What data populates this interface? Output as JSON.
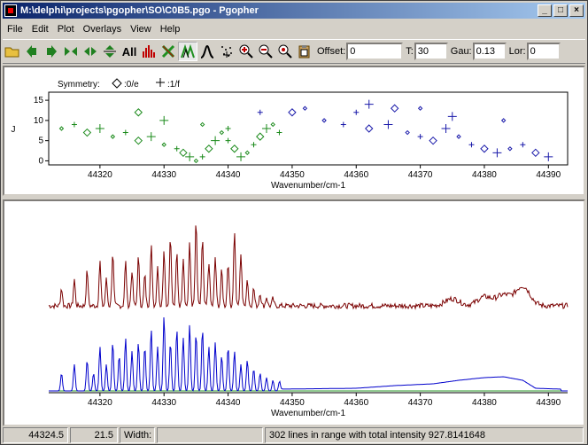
{
  "window": {
    "title": "M:\\delphi\\projects\\pgopher\\SO\\C0B5.pgo - Pgopher"
  },
  "menu": [
    "File",
    "Edit",
    "Plot",
    "Overlays",
    "View",
    "Help"
  ],
  "toolbar": {
    "all_label": "All",
    "offset_label": "Offset:",
    "offset_value": "0",
    "t_label": "T:",
    "t_value": "30",
    "gau_label": "Gau:",
    "gau_value": "0.13",
    "lor_label": "Lor:",
    "lor_value": "0"
  },
  "status": {
    "x": "44324.5",
    "y": "21.5",
    "width_label": "Width:",
    "width_value": "",
    "message": "302 lines in range with total intensity 927.8141648"
  },
  "colors": {
    "e_symmetry": "#1a8a1a",
    "f_symmetry": "#1a1aaa",
    "observed": "#7a0000",
    "simulated": "#0000cc"
  },
  "chart_data": [
    {
      "type": "scatter",
      "title": "",
      "xlabel": "Wavenumber/cm-1",
      "ylabel": "J",
      "legend_title": "Symmetry:",
      "legend": [
        {
          "symbol": "diamond",
          "label": ":0/e"
        },
        {
          "symbol": "cross",
          "label": ":1/f"
        }
      ],
      "xlim": [
        44312,
        44393
      ],
      "ylim": [
        -1,
        17
      ],
      "xticks": [
        44320,
        44330,
        44340,
        44350,
        44360,
        44370,
        44380,
        44390
      ],
      "yticks": [
        0,
        5,
        10,
        15
      ],
      "series": [
        {
          "name": "e",
          "points": [
            [
              44314,
              8
            ],
            [
              44316,
              9
            ],
            [
              44318,
              7
            ],
            [
              44320,
              8
            ],
            [
              44322,
              6
            ],
            [
              44324,
              7
            ],
            [
              44326,
              5
            ],
            [
              44328,
              6
            ],
            [
              44330,
              4
            ],
            [
              44332,
              3
            ],
            [
              44333,
              2
            ],
            [
              44334,
              1
            ],
            [
              44335,
              0
            ],
            [
              44336,
              1
            ],
            [
              44337,
              3
            ],
            [
              44338,
              5
            ],
            [
              44339,
              7
            ],
            [
              44340,
              5
            ],
            [
              44341,
              3
            ],
            [
              44342,
              1
            ],
            [
              44343,
              2
            ],
            [
              44344,
              4
            ],
            [
              44345,
              6
            ],
            [
              44346,
              8
            ],
            [
              44347,
              9
            ],
            [
              44348,
              7
            ],
            [
              44326,
              12
            ],
            [
              44330,
              10
            ],
            [
              44336,
              9
            ],
            [
              44340,
              8
            ]
          ]
        },
        {
          "name": "f",
          "points": [
            [
              44355,
              10
            ],
            [
              44358,
              9
            ],
            [
              44362,
              8
            ],
            [
              44365,
              9
            ],
            [
              44368,
              7
            ],
            [
              44370,
              6
            ],
            [
              44372,
              5
            ],
            [
              44374,
              8
            ],
            [
              44376,
              6
            ],
            [
              44378,
              4
            ],
            [
              44380,
              3
            ],
            [
              44382,
              2
            ],
            [
              44384,
              3
            ],
            [
              44386,
              4
            ],
            [
              44388,
              2
            ],
            [
              44390,
              1
            ],
            [
              44352,
              13
            ],
            [
              44360,
              12
            ],
            [
              44366,
              13
            ],
            [
              44375,
              11
            ],
            [
              44383,
              10
            ],
            [
              44345,
              12
            ],
            [
              44350,
              12
            ],
            [
              44362,
              14
            ],
            [
              44370,
              13
            ]
          ]
        }
      ]
    },
    {
      "type": "line",
      "title": "",
      "xlabel": "Wavenumber/cm-1",
      "xlim": [
        44312,
        44393
      ],
      "xticks": [
        44320,
        44330,
        44340,
        44350,
        44360,
        44370,
        44380,
        44390
      ],
      "series": [
        {
          "name": "",
          "role": "observed",
          "peaks": [
            [
              44314,
              0.2
            ],
            [
              44316,
              0.3
            ],
            [
              44318,
              0.4
            ],
            [
              44320,
              0.5
            ],
            [
              44321,
              0.3
            ],
            [
              44322,
              0.6
            ],
            [
              44324,
              0.5
            ],
            [
              44325,
              0.4
            ],
            [
              44326,
              0.55
            ],
            [
              44327,
              0.35
            ],
            [
              44328,
              0.7
            ],
            [
              44329,
              0.45
            ],
            [
              44330,
              0.65
            ],
            [
              44331,
              0.8
            ],
            [
              44332,
              0.6
            ],
            [
              44333,
              0.55
            ],
            [
              44334,
              0.7
            ],
            [
              44335,
              0.95
            ],
            [
              44336,
              0.75
            ],
            [
              44337,
              0.5
            ],
            [
              44338,
              0.55
            ],
            [
              44339,
              0.4
            ],
            [
              44340,
              0.5
            ],
            [
              44341,
              0.85
            ],
            [
              44342,
              0.6
            ],
            [
              44343,
              0.3
            ],
            [
              44344,
              0.2
            ],
            [
              44345,
              0.15
            ],
            [
              44346,
              0.1
            ],
            [
              44347,
              0.08
            ]
          ],
          "bumps": [
            [
              44375,
              0.08
            ],
            [
              44380,
              0.1
            ],
            [
              44383,
              0.12
            ],
            [
              44386,
              0.22
            ]
          ]
        },
        {
          "name": "",
          "role": "simulated",
          "peaks": [
            [
              44314,
              0.2
            ],
            [
              44316,
              0.3
            ],
            [
              44318,
              0.35
            ],
            [
              44319,
              0.2
            ],
            [
              44320,
              0.5
            ],
            [
              44321,
              0.3
            ],
            [
              44322,
              0.55
            ],
            [
              44323,
              0.4
            ],
            [
              44324,
              0.6
            ],
            [
              44325,
              0.45
            ],
            [
              44326,
              0.55
            ],
            [
              44327,
              0.5
            ],
            [
              44328,
              0.7
            ],
            [
              44329,
              0.5
            ],
            [
              44330,
              0.85
            ],
            [
              44331,
              0.55
            ],
            [
              44332,
              0.7
            ],
            [
              44333,
              0.6
            ],
            [
              44334,
              0.75
            ],
            [
              44335,
              0.65
            ],
            [
              44336,
              0.7
            ],
            [
              44337,
              0.5
            ],
            [
              44338,
              0.55
            ],
            [
              44339,
              0.4
            ],
            [
              44340,
              0.5
            ],
            [
              44341,
              0.45
            ],
            [
              44342,
              0.3
            ],
            [
              44343,
              0.35
            ],
            [
              44344,
              0.25
            ],
            [
              44345,
              0.2
            ],
            [
              44346,
              0.15
            ],
            [
              44347,
              0.12
            ],
            [
              44348,
              0.1
            ]
          ],
          "envelope": [
            [
              44348,
              0.02
            ],
            [
              44360,
              0.03
            ],
            [
              44366,
              0.06
            ],
            [
              44372,
              0.08
            ],
            [
              44376,
              0.12
            ],
            [
              44380,
              0.15
            ],
            [
              44383,
              0.16
            ],
            [
              44386,
              0.12
            ],
            [
              44388,
              0.03
            ],
            [
              44392,
              0.02
            ]
          ]
        }
      ]
    }
  ]
}
